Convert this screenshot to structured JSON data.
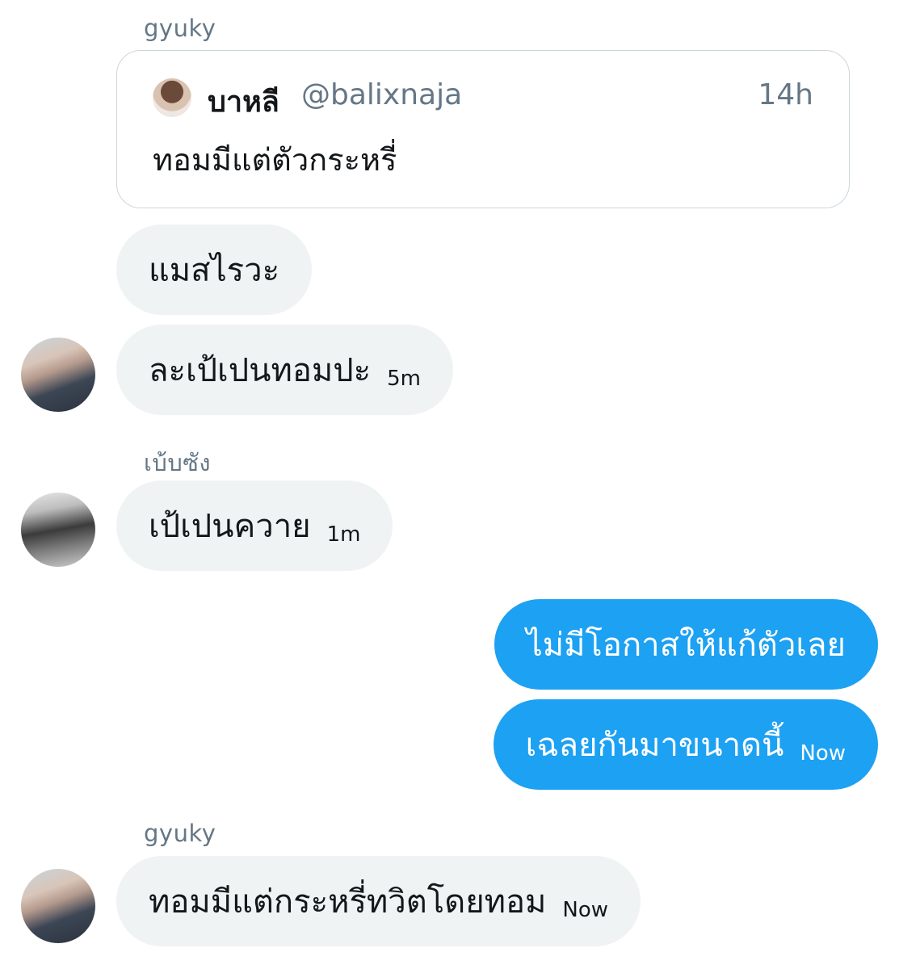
{
  "conversation": {
    "sender_top": "gyuky",
    "quoted_tweet": {
      "name": "บาหลี",
      "handle": "@balixnaja",
      "time": "14h",
      "text": "ทอมมีแต่ตัวกระหรี่"
    },
    "group1_messages": [
      {
        "text": "แมสไรวะ"
      },
      {
        "text": "ละเป้เปนทอมปะ",
        "time": "5m"
      }
    ],
    "sender_middle": "เบ้บซัง",
    "group2_message": {
      "text": "เป้เปนควาย",
      "time": "1m"
    },
    "outgoing_messages": [
      {
        "text": "ไม่มีโอกาสให้แก้ตัวเลย"
      },
      {
        "text": "เฉลยกันมาขนาดนี้",
        "time": "Now"
      }
    ],
    "sender_bottom": "gyuky",
    "group3_message": {
      "text": "ทอมมีแต่กระหรี่ทวิตโดยทอม",
      "time": "Now"
    }
  },
  "colors": {
    "incoming_bubble": "#eff3f4",
    "outgoing_bubble": "#1da1f2",
    "secondary_text": "#657786"
  }
}
